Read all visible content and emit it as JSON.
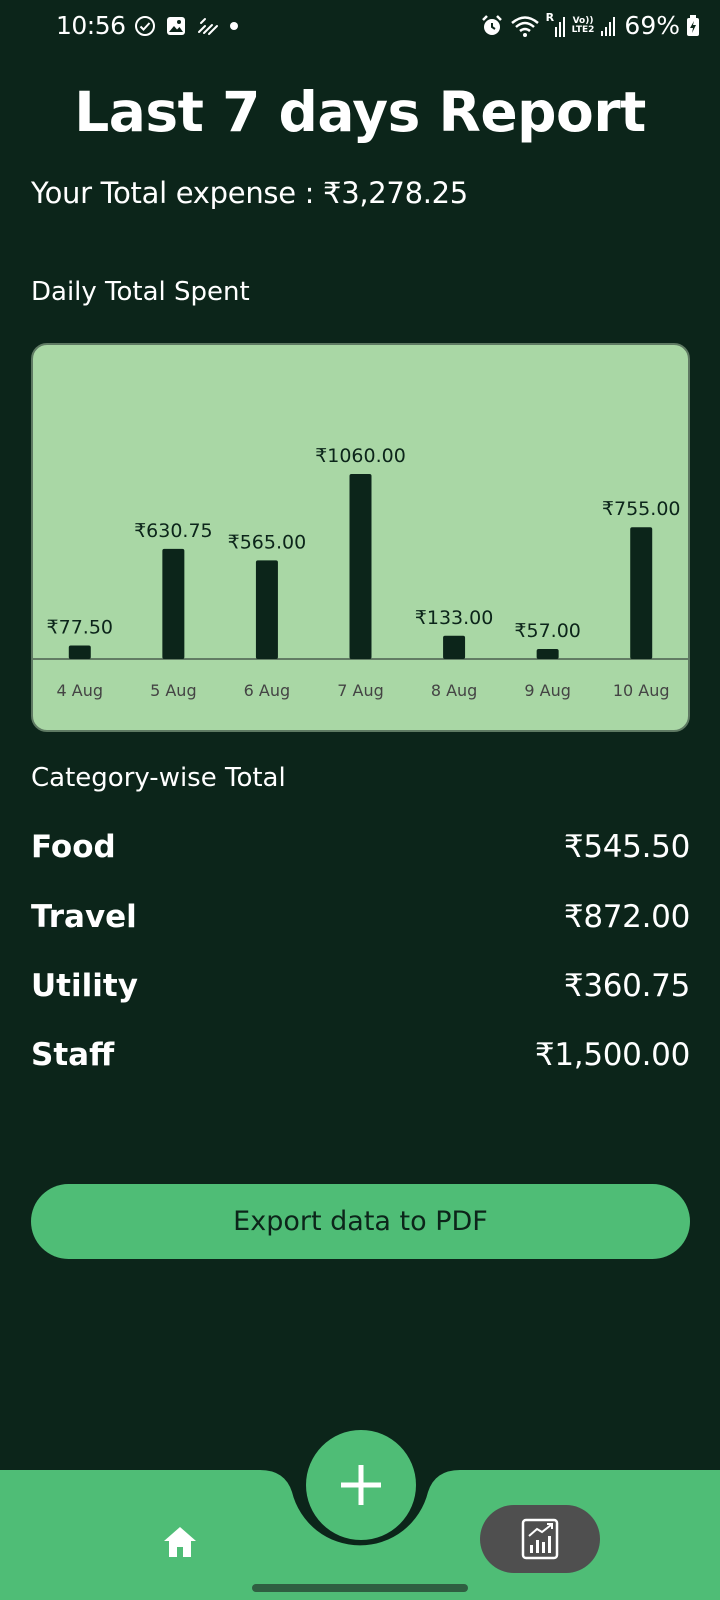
{
  "status_bar": {
    "time": "10:56",
    "battery": "69%",
    "net_line1": "Vo))",
    "net_line2": "LTE2",
    "roaming": "R"
  },
  "header": {
    "title": "Last 7 days Report",
    "total_label": "Your Total expense : ₹3,278.25"
  },
  "daily": {
    "label": "Daily Total Spent"
  },
  "chart_data": {
    "type": "bar",
    "categories": [
      "4 Aug",
      "5 Aug",
      "6 Aug",
      "7 Aug",
      "8 Aug",
      "9 Aug",
      "10 Aug"
    ],
    "values": [
      77.5,
      630.75,
      565,
      1060,
      133,
      57,
      755
    ],
    "data_labels": [
      "₹77.50",
      "₹630.75",
      "₹565.00",
      "₹1060.00",
      "₹133.00",
      "₹57.00",
      "₹755.00"
    ],
    "title": "",
    "xlabel": "",
    "ylabel": "",
    "ylim": [
      0,
      1060
    ],
    "grid": false,
    "colors": {
      "bar": "#0c251a",
      "background": "#a9d7a5",
      "label": "#0c251a",
      "tick": "#444444"
    }
  },
  "category": {
    "label": "Category-wise Total",
    "items": [
      {
        "name": "Food",
        "value": "₹545.50"
      },
      {
        "name": "Travel",
        "value": "₹872.00"
      },
      {
        "name": "Utility",
        "value": "₹360.75"
      },
      {
        "name": "Staff",
        "value": "₹1,500.00"
      }
    ]
  },
  "actions": {
    "export_label": "Export data to PDF"
  },
  "nav": {
    "fab_icon": "plus-icon",
    "home_icon": "home-icon",
    "report_icon": "report-chart-icon"
  },
  "colors": {
    "background": "#0c251a",
    "accent": "#4fbd76",
    "chart_bg": "#a9d7a5",
    "report_pill": "#4f4f4f"
  }
}
